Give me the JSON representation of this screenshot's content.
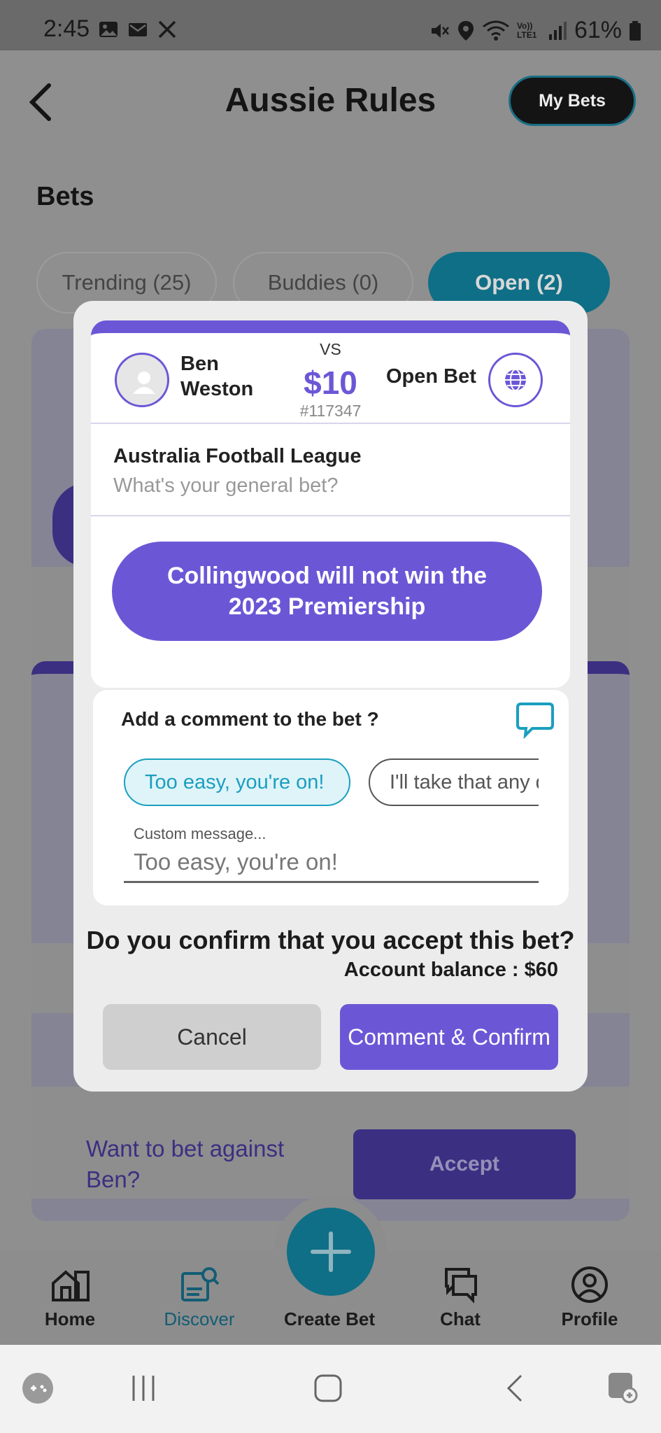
{
  "status_bar": {
    "time": "2:45",
    "left_icons": [
      "image-icon",
      "mail-icon",
      "x-logo-icon"
    ],
    "right_icons": [
      "mute-icon",
      "location-icon",
      "wifi-icon",
      "volte-icon",
      "signal-icon"
    ],
    "volte_label": "Vo)) LTE1",
    "battery": "61%"
  },
  "header": {
    "title": "Aussie Rules",
    "my_bets": "My Bets"
  },
  "page": {
    "heading": "Bets",
    "tabs": [
      "Trending (25)",
      "Buddies (0)",
      "Open (2)"
    ],
    "active_tab": "Open (2)",
    "want_text": "Want to bet against Ben?",
    "accept_label": "Accept"
  },
  "modal": {
    "bet": {
      "player": "Ben Weston",
      "vs": "VS",
      "amount": "$10",
      "bet_id": "#117347",
      "opponent": "Open Bet",
      "league": "Australia Football League",
      "question": "What's your general bet?",
      "statement": "Collingwood will not win the 2023 Premiership"
    },
    "comment": {
      "title": "Add a comment to the bet ?",
      "chips": [
        "Too easy, you're on!",
        "I'll take that any da"
      ],
      "selected_chip": "Too easy, you're on!",
      "custom_label": "Custom message...",
      "custom_value": "Too easy, you're on!"
    },
    "confirm_question": "Do you confirm that you accept this bet?",
    "balance": "Account balance : $60",
    "cancel": "Cancel",
    "confirm": "Comment & Confirm"
  },
  "bottom_nav": {
    "items": [
      {
        "label": "Home",
        "icon": "home-icon"
      },
      {
        "label": "Discover",
        "icon": "discover-icon"
      },
      {
        "label": "Create Bet",
        "icon": "plus-icon"
      },
      {
        "label": "Chat",
        "icon": "chat-icon"
      },
      {
        "label": "Profile",
        "icon": "profile-icon"
      }
    ],
    "active": "Discover"
  },
  "colors": {
    "primary_purple": "#6b57d6",
    "teal": "#1a9fbf",
    "dark_teal": "#0f6f86",
    "overlay_gray": "#8f8f8f"
  }
}
